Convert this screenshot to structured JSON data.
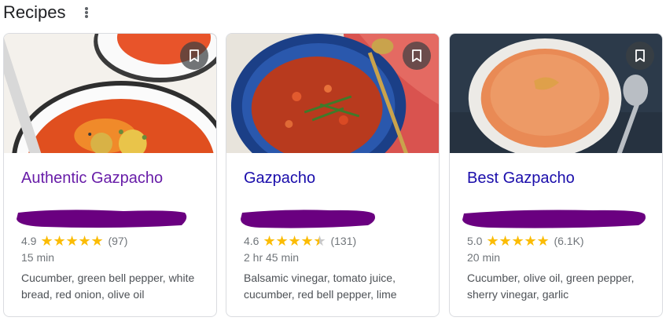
{
  "section": {
    "title": "Recipes",
    "menu_icon": "more-vert-icon"
  },
  "bookmark_icon": "bookmark-icon",
  "colors": {
    "visited_link": "#681da8",
    "link": "#1a0dab",
    "star": "#fbbc04",
    "redaction": "#6a0080",
    "meta_text": "#70757a"
  },
  "recipes": [
    {
      "title": "Authentic Gazpacho",
      "visited": true,
      "rating": "4.9",
      "rating_value": 4.9,
      "reviews": "(97)",
      "time": "15 min",
      "ingredients": "Cucumber, green bell pepper, white bread, red onion, olive oil"
    },
    {
      "title": "Gazpacho",
      "visited": false,
      "rating": "4.6",
      "rating_value": 4.6,
      "reviews": "(131)",
      "time": "2 hr 45 min",
      "ingredients": "Balsamic vinegar, tomato juice, cucumber, red bell pepper, lime"
    },
    {
      "title": "Best Gazpacho",
      "visited": false,
      "rating": "5.0",
      "rating_value": 5.0,
      "reviews": "(6.1K)",
      "time": "20 min",
      "ingredients": "Cucumber, olive oil, green pepper, sherry vinegar, garlic"
    }
  ]
}
